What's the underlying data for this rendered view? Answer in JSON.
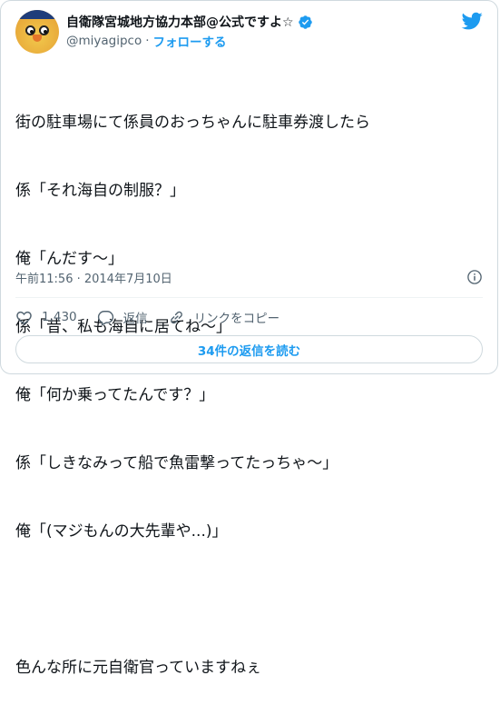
{
  "author": {
    "name": "自衛隊宮城地方協力本部@公式ですよ☆",
    "handle": "@miyagipco",
    "separator": "·",
    "follow_label": "フォローする",
    "avatar": "owl-mascot-avatar",
    "verified_icon": "verified-badge-icon"
  },
  "tweet": {
    "lines": [
      "街の駐車場にて係員のおっちゃんに駐車券渡したら",
      "係「それ海自の制服？」",
      "俺「んだす〜」",
      "係「昔、私も海自に居てね〜」",
      "俺「何か乗ってたんです？」",
      "係「しきなみって船で魚雷撃ってたっちゃ〜」",
      "俺「(マジもんの大先輩や...)」",
      "",
      "色んな所に元自衛官っていますねぇ"
    ],
    "timestamp": "午前11:56 · 2014年7月10日"
  },
  "actions": {
    "like_count": "1,430",
    "reply_label": "返信",
    "share_label": "リンクをコピー"
  },
  "read_replies_label": "34件の返信を読む",
  "colors": {
    "accent": "#1d9bf0",
    "text": "#0f1419",
    "muted": "#536471",
    "border": "#cfd9de"
  },
  "icons": [
    "twitter-bird-icon",
    "info-icon",
    "heart-icon",
    "reply-icon",
    "link-icon"
  ]
}
